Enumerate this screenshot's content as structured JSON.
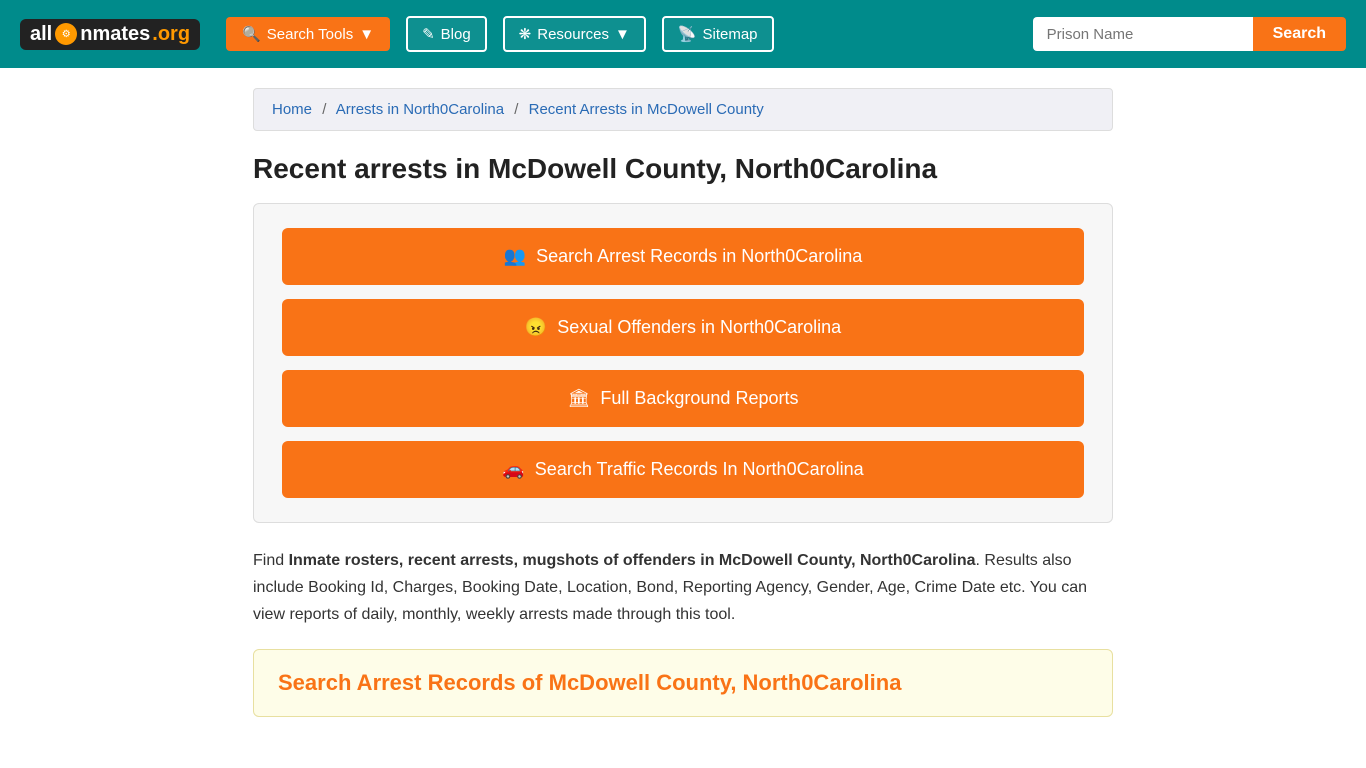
{
  "site": {
    "logo_all": "all",
    "logo_inmates": "Inmates",
    "logo_org": ".org"
  },
  "header": {
    "search_tools_label": "Search Tools",
    "blog_label": "Blog",
    "resources_label": "Resources",
    "sitemap_label": "Sitemap",
    "prison_input_placeholder": "Prison Name",
    "search_button_label": "Search"
  },
  "breadcrumb": {
    "home_label": "Home",
    "separator1": "/",
    "arrests_label": "Arrests in North0Carolina",
    "separator2": "/",
    "current_label": "Recent Arrests in McDowell County"
  },
  "page": {
    "title": "Recent arrests in McDowell County, North0Carolina"
  },
  "action_buttons": [
    {
      "icon": "👥",
      "label": "Search Arrest Records in North0Carolina"
    },
    {
      "icon": "😠",
      "label": "Sexual Offenders in North0Carolina"
    },
    {
      "icon": "🏛",
      "label": "Full Background Reports"
    },
    {
      "icon": "🚗",
      "label": "Search Traffic Records In North0Carolina"
    }
  ],
  "description": {
    "prefix": "Find ",
    "bold_text": "Inmate rosters, recent arrests, mugshots of offenders in McDowell County, North0Carolina",
    "suffix": ". Results also include Booking Id, Charges, Booking Date, Location, Bond, Reporting Agency, Gender, Age, Crime Date etc. You can view reports of daily, monthly, weekly arrests made through this tool."
  },
  "bottom_section": {
    "title": "Search Arrest Records of McDowell County, North0Carolina"
  }
}
